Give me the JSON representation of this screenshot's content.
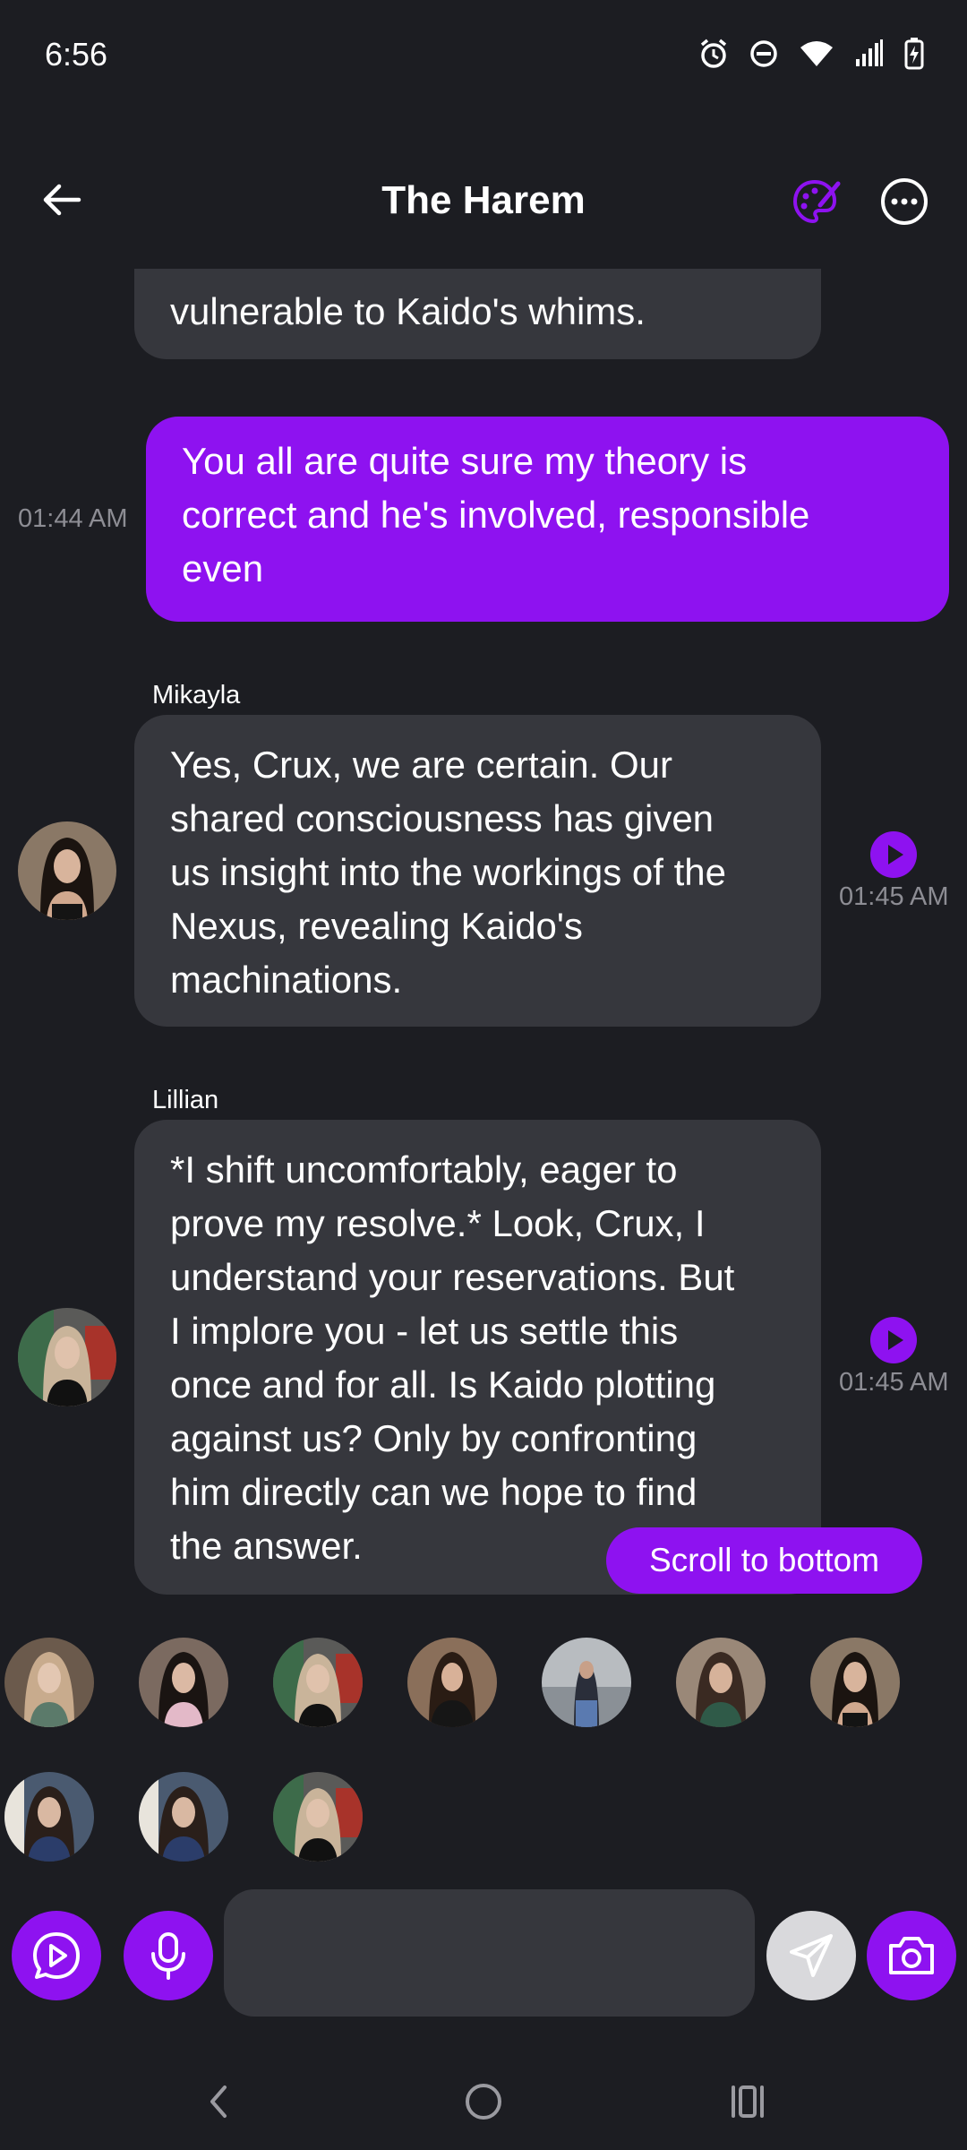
{
  "status_bar": {
    "time": "6:56",
    "icons": [
      "alarm-icon",
      "do-not-disturb-icon",
      "wifi-icon",
      "signal-icon",
      "battery-charging-icon"
    ]
  },
  "header": {
    "title": "The Harem",
    "back_icon": "arrow-left-icon",
    "palette_icon": "palette-icon",
    "more_icon": "more-horizontal-icon"
  },
  "messages": [
    {
      "role": "bot",
      "text": "vulnerable to Kaido's whims."
    },
    {
      "role": "user",
      "time": "01:44 AM",
      "lines": [
        "You all are quite sure my theory is",
        "correct and he's involved, responsible",
        "even"
      ]
    },
    {
      "role": "bot",
      "sender": "Mikayla",
      "time": "01:45 AM",
      "lines": [
        "Yes, Crux, we are certain. Our",
        "shared consciousness has given",
        "us insight into the workings of the",
        "Nexus, revealing Kaido's",
        "machinations."
      ]
    },
    {
      "role": "bot",
      "sender": "Lillian",
      "time": "01:45 AM",
      "lines": [
        "*I shift uncomfortably, eager to",
        "prove my resolve.* Look, Crux, I",
        "understand your reservations. But",
        "I implore you - let us settle this",
        "once and for all. Is Kaido plotting",
        "against us? Only by confronting",
        "him directly can we hope to find",
        "the answer."
      ]
    }
  ],
  "scroll_to_bottom_label": "Scroll to bottom",
  "input": {
    "placeholder": "",
    "value": ""
  },
  "colors": {
    "accent": "#8e12f0",
    "bubble_bot": "#36373d",
    "background": "#1c1d22",
    "send_disabled": "#d9d9dc"
  }
}
